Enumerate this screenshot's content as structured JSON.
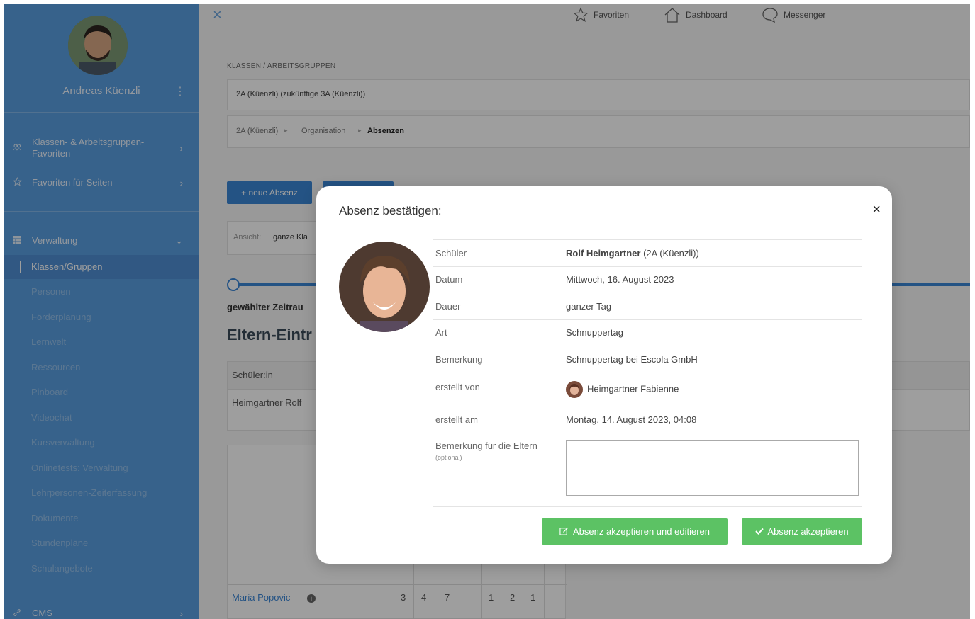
{
  "sidebar": {
    "user_name": "Andreas Küenzli",
    "kebab": "⋮",
    "items": [
      {
        "label": "Klassen- & Arbeitsgruppen-Favoriten",
        "icon": "users-icon"
      },
      {
        "label": "Favoriten für Seiten",
        "icon": "star-icon"
      },
      {
        "label": "Verwaltung",
        "icon": "grid-icon"
      },
      {
        "label": "CMS",
        "icon": "link-icon"
      }
    ],
    "subitems": [
      "Klassen/Gruppen",
      "Personen",
      "Förderplanung",
      "Lernwelt",
      "Ressourcen",
      "Pinboard",
      "Videochat",
      "Kursverwaltung",
      "Onlinetests: Verwaltung",
      "Lehrpersonen-Zeiterfassung",
      "Dokumente",
      "Stundenpläne",
      "Schulangebote"
    ],
    "active_subitem": "Klassen/Gruppen"
  },
  "topbar": {
    "close": "×",
    "favorites": "Favoriten",
    "dashboard": "Dashboard",
    "messenger": "Messenger"
  },
  "content": {
    "section_label": "KLASSEN / ARBEITSGRUPPEN",
    "class_select": "2A (Küenzli) (zukünftige 3A (Küenzli))",
    "breadcrumb": {
      "part1": "2A (Küenzli)",
      "sep": "▸",
      "part2": "Organisation",
      "part3": "Absenzen"
    },
    "new_absence": "+ neue Absenz",
    "view_label": "Ansicht:",
    "view_value": "ganze Kla",
    "period_label": "gewählter Zeitrau",
    "heading": "Eltern-Eintr",
    "table_header": "Schüler:in",
    "row_name": "Heimgartner Rolf",
    "student_link": "Maria Popovic",
    "info": "i",
    "counts": [
      "3",
      "4",
      "7",
      "1",
      "2",
      "1"
    ]
  },
  "modal": {
    "title": "Absenz bestätigen:",
    "close": "×",
    "rows": {
      "schueler_label": "Schüler",
      "schueler_name": "Rolf Heimgartner",
      "schueler_class": "(2A (Küenzli))",
      "datum_label": "Datum",
      "datum_value": "Mittwoch, 16. August 2023",
      "dauer_label": "Dauer",
      "dauer_value": "ganzer Tag",
      "art_label": "Art",
      "art_value": "Schnuppertag",
      "bemerkung_label": "Bemerkung",
      "bemerkung_value": "Schnuppertag bei Escola GmbH",
      "erstellt_von_label": "erstellt von",
      "erstellt_von_value": "Heimgartner Fabienne",
      "erstellt_am_label": "erstellt am",
      "erstellt_am_value": "Montag, 14. August 2023, 04:08",
      "parents_label": "Bemerkung für die Eltern",
      "optional": "(optional)"
    },
    "btn_edit": "Absenz akzeptieren und editieren",
    "btn_accept": "Absenz akzeptieren"
  }
}
